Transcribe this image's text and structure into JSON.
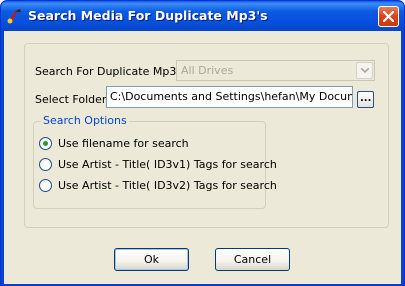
{
  "window": {
    "title": "Search Media For Duplicate Mp3's",
    "icon": "app-music-icon",
    "close_icon": "close-icon"
  },
  "search_for": {
    "label": "Search For Duplicate Mp3's",
    "selected": "All Drives",
    "disabled": true
  },
  "folder": {
    "label": "Select Folder",
    "value": "C:\\Documents and Settings\\hefan\\My Documents",
    "browse_label": "..."
  },
  "options": {
    "legend": "Search Options",
    "items": [
      {
        "label": "Use filename for search",
        "checked": true
      },
      {
        "label": "Use Artist - Title( ID3v1) Tags for search",
        "checked": false
      },
      {
        "label": "Use Artist - Title( ID3v2) Tags for search",
        "checked": false
      }
    ]
  },
  "buttons": {
    "ok": "Ok",
    "cancel": "Cancel"
  },
  "colors": {
    "title_bar": "#0b5be1",
    "client_bg": "#ece9d8",
    "legend_text": "#0046d5",
    "radio_checked": "#21a121"
  }
}
